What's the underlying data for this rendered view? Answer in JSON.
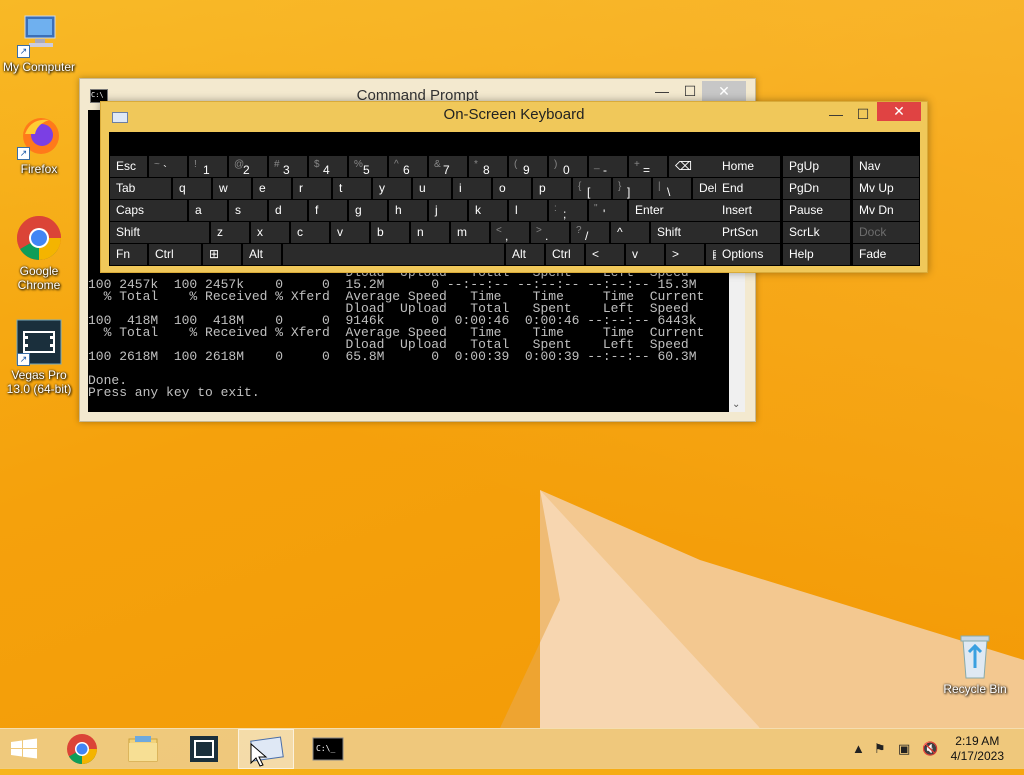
{
  "desktop": {
    "icons": [
      {
        "label": "My Computer"
      },
      {
        "label": "Firefox"
      },
      {
        "label": "Google Chrome"
      },
      {
        "label": "Vegas Pro 13.0 (64-bit)"
      },
      {
        "label": "Recycle Bin"
      }
    ]
  },
  "cmd": {
    "title": "Command Prompt",
    "lines": [
      "                                 Dload  Upload   Total   Spent    Left  Speed",
      "100 2457k  100 2457k    0     0  15.2M      0 --:--:-- --:--:-- --:--:-- 15.3M",
      "  % Total    % Received % Xferd  Average Speed   Time    Time     Time  Current",
      "                                 Dload  Upload   Total   Spent    Left  Speed",
      "100  418M  100  418M    0     0  9146k      0  0:00:46  0:00:46 --:--:-- 6443k",
      "  % Total    % Received % Xferd  Average Speed   Time    Time     Time  Current",
      "                                 Dload  Upload   Total   Spent    Left  Speed",
      "100 2618M  100 2618M    0     0  65.8M      0  0:00:39  0:00:39 --:--:-- 60.3M",
      "",
      "Done.",
      "Press any key to exit."
    ]
  },
  "osk": {
    "title": "On-Screen Keyboard",
    "rows": [
      [
        {
          "label": "Esc"
        },
        {
          "sub": "~",
          "label": "`"
        },
        {
          "sub": "!",
          "label": "1"
        },
        {
          "sub": "@",
          "label": "2"
        },
        {
          "sub": "#",
          "label": "3"
        },
        {
          "sub": "$",
          "label": "4"
        },
        {
          "sub": "%",
          "label": "5"
        },
        {
          "sub": "^",
          "label": "6"
        },
        {
          "sub": "&",
          "label": "7"
        },
        {
          "sub": "*",
          "label": "8"
        },
        {
          "sub": "(",
          "label": "9"
        },
        {
          "sub": ")",
          "label": "0"
        },
        {
          "sub": "_",
          "label": "-"
        },
        {
          "sub": "+",
          "label": "="
        },
        {
          "label": "⌫"
        }
      ],
      [
        {
          "label": "Tab"
        },
        {
          "label": "q"
        },
        {
          "label": "w"
        },
        {
          "label": "e"
        },
        {
          "label": "r"
        },
        {
          "label": "t"
        },
        {
          "label": "y"
        },
        {
          "label": "u"
        },
        {
          "label": "i"
        },
        {
          "label": "o"
        },
        {
          "label": "p"
        },
        {
          "sub": "{",
          "label": "["
        },
        {
          "sub": "}",
          "label": "]"
        },
        {
          "sub": "|",
          "label": "\\"
        },
        {
          "label": "Del"
        }
      ],
      [
        {
          "label": "Caps"
        },
        {
          "label": "a"
        },
        {
          "label": "s"
        },
        {
          "label": "d"
        },
        {
          "label": "f"
        },
        {
          "label": "g"
        },
        {
          "label": "h"
        },
        {
          "label": "j"
        },
        {
          "label": "k"
        },
        {
          "label": "l"
        },
        {
          "sub": ":",
          "label": ";"
        },
        {
          "sub": "\"",
          "label": "'"
        },
        {
          "label": "Enter"
        }
      ],
      [
        {
          "label": "Shift"
        },
        {
          "label": "z"
        },
        {
          "label": "x"
        },
        {
          "label": "c"
        },
        {
          "label": "v"
        },
        {
          "label": "b"
        },
        {
          "label": "n"
        },
        {
          "label": "m"
        },
        {
          "sub": "<",
          "label": ","
        },
        {
          "sub": ">",
          "label": "."
        },
        {
          "sub": "?",
          "label": "/"
        },
        {
          "label": "^"
        },
        {
          "label": "Shift"
        }
      ],
      [
        {
          "label": "Fn"
        },
        {
          "label": "Ctrl"
        },
        {
          "label": "⊞"
        },
        {
          "label": "Alt"
        },
        {
          "label": ""
        },
        {
          "label": "Alt"
        },
        {
          "label": "Ctrl"
        },
        {
          "label": "<"
        },
        {
          "label": "v"
        },
        {
          "label": ">"
        },
        {
          "label": "▤"
        }
      ]
    ],
    "nav": [
      [
        "Home",
        "PgUp",
        "Nav"
      ],
      [
        "End",
        "PgDn",
        "Mv Up"
      ],
      [
        "Insert",
        "Pause",
        "Mv Dn"
      ],
      [
        "PrtScn",
        "ScrLk",
        "Dock"
      ],
      [
        "Options",
        "Help",
        "Fade"
      ]
    ]
  },
  "taskbar": {
    "clock_time": "2:19 AM",
    "clock_date": "4/17/2023"
  }
}
